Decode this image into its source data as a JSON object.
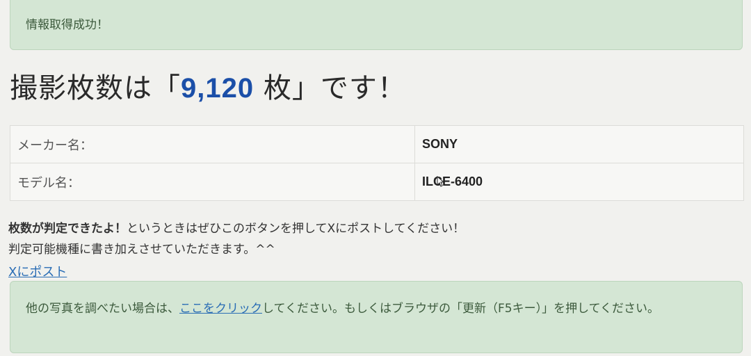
{
  "alert_top": {
    "text": "情報取得成功！"
  },
  "headline": {
    "prefix": "撮影枚数は「",
    "count": "9,120",
    "suffix": " 枚」です！"
  },
  "table": {
    "rows": [
      {
        "label": "メーカー名：",
        "value": "SONY"
      },
      {
        "label": "モデル名：",
        "value": "ILCE-6400"
      }
    ]
  },
  "notice": {
    "bold": "枚数が判定できたよ！",
    "line1_rest": "というときはぜひこのボタンを押してXにポストしてください！",
    "line2": "判定可能機種に書き加えさせていただきます。^^"
  },
  "post_link": "Xにポスト",
  "alert_bottom": {
    "before": "他の写真を調べたい場合は、",
    "link": "ここをクリック",
    "after": "してください。もしくはブラウザの「更新（F5キー）」を押してください。"
  },
  "colors": {
    "accent": "#1b4fa8",
    "link": "#2a6db5",
    "alert_bg": "#d4e6d4"
  }
}
